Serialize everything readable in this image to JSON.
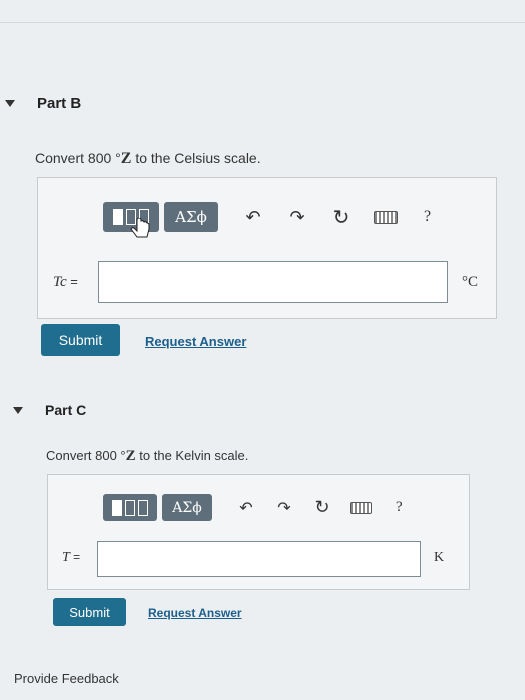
{
  "part_b": {
    "title": "Part B",
    "prompt_prefix": "Convert 800 °",
    "prompt_var": "Z",
    "prompt_suffix": " to the Celsius scale.",
    "toolbar": {
      "templates_icon": "template-icon",
      "symbols_label": "ΑΣϕ",
      "undo_icon": "undo-icon",
      "redo_icon": "redo-icon",
      "reset_icon": "reset-icon",
      "keyboard_icon": "keyboard-icon",
      "help_label": "?"
    },
    "var_label": "Tc",
    "equals": " =",
    "input_value": "",
    "unit": "°C",
    "submit_label": "Submit",
    "request_label": "Request Answer"
  },
  "part_c": {
    "title": "Part C",
    "prompt_prefix": "Convert 800 °",
    "prompt_var": "Z",
    "prompt_suffix": " to the Kelvin scale.",
    "toolbar": {
      "templates_icon": "template-icon",
      "symbols_label": "ΑΣϕ",
      "undo_icon": "undo-icon",
      "redo_icon": "redo-icon",
      "reset_icon": "reset-icon",
      "keyboard_icon": "keyboard-icon",
      "help_label": "?"
    },
    "var_label": "T",
    "equals": " =",
    "input_value": "",
    "unit": "K",
    "submit_label": "Submit",
    "request_label": "Request Answer"
  },
  "footer": {
    "feedback_label": "Provide Feedback"
  },
  "colors": {
    "submit_bg": "#1f6d8f",
    "toolbar_bg": "#5e6f7b",
    "link": "#1c5f8c"
  }
}
